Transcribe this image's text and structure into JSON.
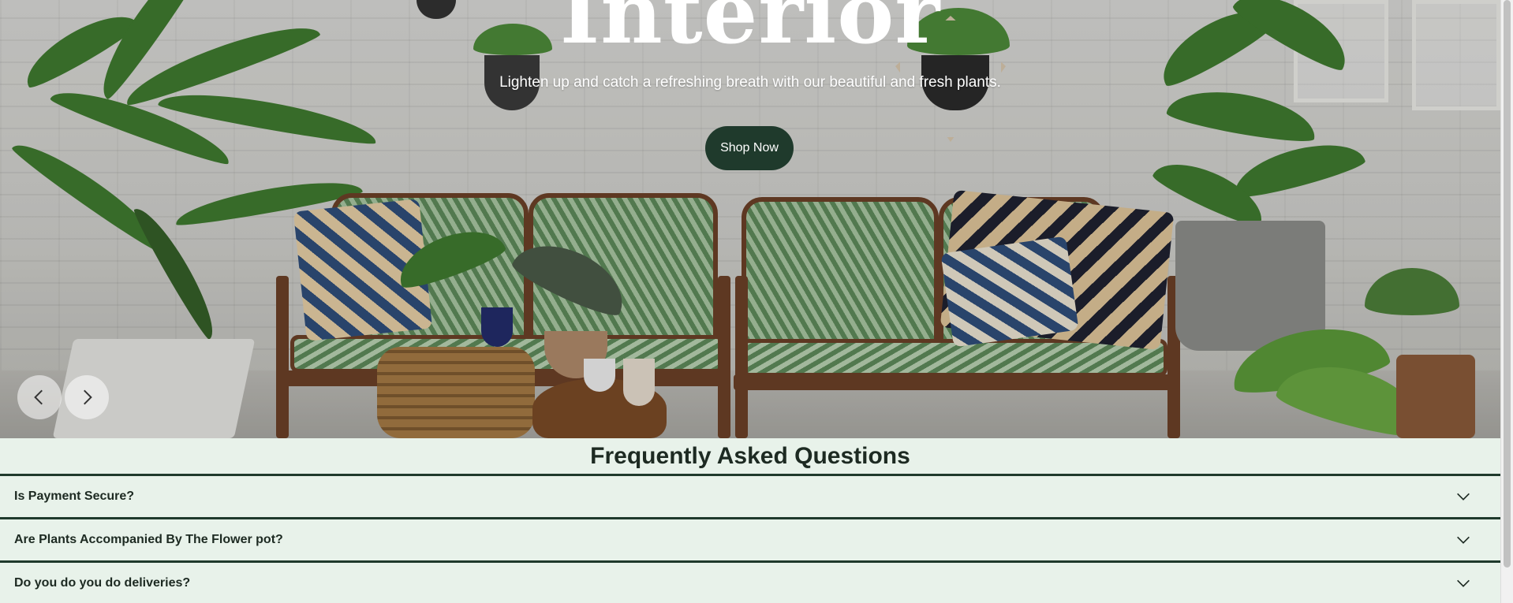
{
  "hero": {
    "title": "Interior",
    "subtitle": "Lighten up and catch a refreshing breath with our beautiful and fresh plants.",
    "cta_label": "Shop Now",
    "prev_icon": "chevron-left-icon",
    "next_icon": "chevron-right-icon"
  },
  "faq": {
    "title": "Frequently Asked Questions",
    "items": [
      {
        "question": "Is Payment Secure?",
        "icon": "chevron-down-icon"
      },
      {
        "question": "Are Plants Accompanied By The Flower pot?",
        "icon": "chevron-down-icon"
      },
      {
        "question": "Do you do you do deliveries?",
        "icon": "chevron-down-icon"
      }
    ]
  },
  "colors": {
    "accent_dark_green": "#1f3a2c",
    "faq_background": "#e8f2ea",
    "text_dark": "#1d2a22"
  }
}
